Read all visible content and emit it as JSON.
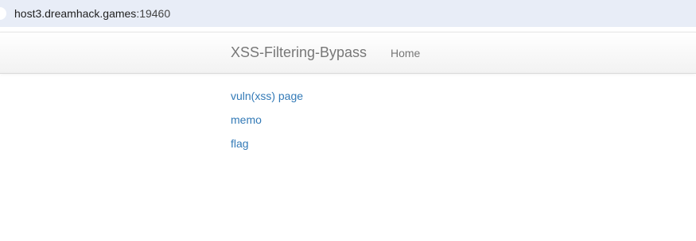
{
  "browser": {
    "url_host": "host3.dreamhack.games",
    "url_port": ":19460"
  },
  "navbar": {
    "brand": "XSS-Filtering-Bypass",
    "home_label": "Home"
  },
  "main": {
    "links": [
      {
        "label": "vuln(xss) page"
      },
      {
        "label": "memo"
      },
      {
        "label": "flag"
      }
    ]
  },
  "colors": {
    "link": "#337ab7",
    "navbar_text": "#777777",
    "addressbar_bg": "#e8edf7"
  }
}
